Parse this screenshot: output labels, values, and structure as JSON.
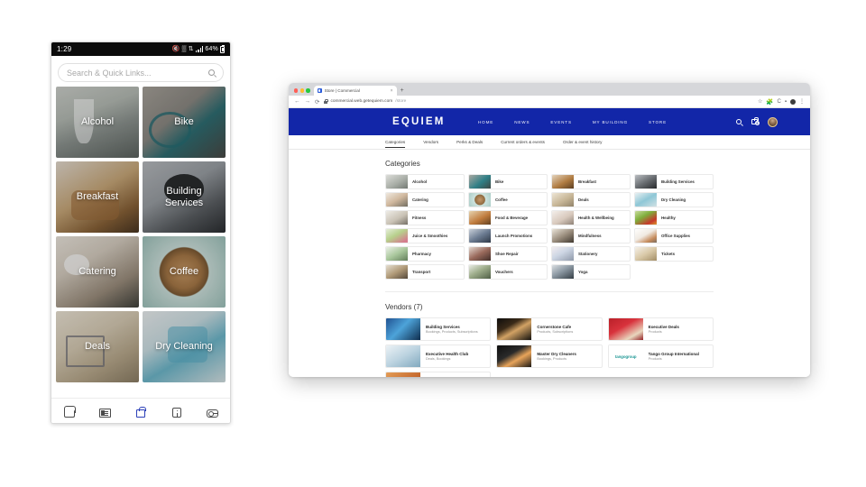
{
  "phone": {
    "status_bar": {
      "time": "1:29",
      "battery_percent": "64%",
      "icons": [
        "mute-icon",
        "wifi-icon",
        "data-transfer-icon",
        "signal-icon",
        "battery-icon"
      ]
    },
    "search": {
      "placeholder": "Search & Quick Links...",
      "icon": "search-icon"
    },
    "tiles": [
      {
        "label": "Alcohol",
        "bg": "bg-alcohol"
      },
      {
        "label": "Bike",
        "bg": "bg-bike"
      },
      {
        "label": "Breakfast",
        "bg": "bg-breakfast"
      },
      {
        "label": "Building Services",
        "bg": "bg-building"
      },
      {
        "label": "Catering",
        "bg": "bg-catering"
      },
      {
        "label": "Coffee",
        "bg": "bg-coffee"
      },
      {
        "label": "Deals",
        "bg": "bg-deals"
      },
      {
        "label": "Dry Cleaning",
        "bg": "bg-dry"
      }
    ],
    "bottom_nav": [
      {
        "name": "home",
        "icon": "home-icon",
        "active": false
      },
      {
        "name": "news",
        "icon": "news-icon",
        "active": false
      },
      {
        "name": "store",
        "icon": "shopping-bag-icon",
        "active": true
      },
      {
        "name": "info",
        "icon": "info-icon",
        "active": false
      },
      {
        "name": "access",
        "icon": "key-icon",
        "active": false
      }
    ],
    "system_nav": {
      "recents": "|||",
      "home": "",
      "back": "‹"
    },
    "accent_color": "#2b3fb8"
  },
  "browser": {
    "traffic_lights": [
      "#ff5f57",
      "#febc2e",
      "#28c840"
    ],
    "tab": {
      "title": "Store | Commercial",
      "close": "×",
      "favicon": "site-favicon"
    },
    "new_tab": "+",
    "toolbar": {
      "back": "←",
      "forward": "→",
      "reload": "⟳",
      "lock_icon": "lock-icon"
    },
    "url": {
      "domain": "commercial.web.getequiem.com",
      "path": "/store"
    },
    "toolbar_right": [
      "star-icon",
      "puzzle-icon",
      "extension-c-icon",
      "extension-icon",
      "profile-avatar",
      "menu-icon"
    ]
  },
  "site": {
    "brand": "EQUIEM",
    "brand_color": "#1226A8",
    "nav": [
      "HOME",
      "NEWS",
      "EVENTS",
      "MY BUILDING",
      "STORE"
    ],
    "nav_icons": {
      "search": "search-icon",
      "cart": "cart-icon",
      "cart_badge": "0",
      "avatar": "user-avatar"
    },
    "subnav": [
      {
        "label": "Categories",
        "active": true
      },
      {
        "label": "Vendors",
        "active": false
      },
      {
        "label": "Perks & Deals",
        "active": false
      },
      {
        "label": "Current orders & events",
        "active": false
      },
      {
        "label": "Order & event history",
        "active": false
      }
    ],
    "categories_title": "Categories",
    "categories": [
      {
        "label": "Alcohol",
        "thumb": "t-alcohol"
      },
      {
        "label": "Bike",
        "thumb": "t-bike"
      },
      {
        "label": "Breakfast",
        "thumb": "t-breakfast"
      },
      {
        "label": "Building Services",
        "thumb": "t-building"
      },
      {
        "label": "Catering",
        "thumb": "t-catering"
      },
      {
        "label": "Coffee",
        "thumb": "t-coffee"
      },
      {
        "label": "Deals",
        "thumb": "t-deals"
      },
      {
        "label": "Dry Cleaning",
        "thumb": "t-dry"
      },
      {
        "label": "Fitness",
        "thumb": "t-fitness"
      },
      {
        "label": "Food & Beverage",
        "thumb": "t-food"
      },
      {
        "label": "Health & Wellbeing",
        "thumb": "t-health"
      },
      {
        "label": "Healthy",
        "thumb": "t-healthy"
      },
      {
        "label": "Juice & Smoothies",
        "thumb": "t-juice"
      },
      {
        "label": "Launch Promotions",
        "thumb": "t-launch"
      },
      {
        "label": "Mindfulness",
        "thumb": "t-mind"
      },
      {
        "label": "Office Supplies",
        "thumb": "t-office"
      },
      {
        "label": "Pharmacy",
        "thumb": "t-pharmacy"
      },
      {
        "label": "Shoe Repair",
        "thumb": "t-shoe"
      },
      {
        "label": "Stationery",
        "thumb": "t-stationery"
      },
      {
        "label": "Tickets",
        "thumb": "t-tickets"
      },
      {
        "label": "Transport",
        "thumb": "t-transport"
      },
      {
        "label": "Vouchers",
        "thumb": "t-vouchers"
      },
      {
        "label": "Yoga",
        "thumb": "t-yoga"
      }
    ],
    "vendors_title": "Vendors (7)",
    "vendors": [
      {
        "name": "Building Services",
        "sub": "Bookings, Products, Subscriptions",
        "thumb": "v-building"
      },
      {
        "name": "Cornerstone Cafe",
        "sub": "Products, Subscriptions",
        "thumb": "v-cornerstone"
      },
      {
        "name": "Executive Deals",
        "sub": "Products",
        "thumb": "v-execdeals"
      },
      {
        "name": "Executive Health Club",
        "sub": "Deals, Bookings",
        "thumb": "v-healthclub"
      },
      {
        "name": "Master Dry Cleaners",
        "sub": "Bookings, Products",
        "thumb": "v-drycleaners"
      },
      {
        "name": "Tango Group International",
        "sub": "Products",
        "thumb": "v-tango",
        "logo_text": "tangogroup"
      }
    ]
  }
}
